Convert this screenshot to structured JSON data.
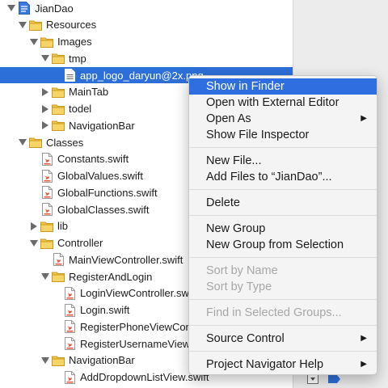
{
  "navigator": {
    "rows": [
      {
        "label": "JianDao",
        "icon": "xcode-project-icon",
        "indent": 0,
        "tri": "open",
        "selected": false
      },
      {
        "label": "Resources",
        "icon": "folder-icon",
        "indent": 1,
        "tri": "open",
        "selected": false
      },
      {
        "label": "Images",
        "icon": "folder-icon",
        "indent": 2,
        "tri": "open",
        "selected": false
      },
      {
        "label": "tmp",
        "icon": "folder-icon",
        "indent": 3,
        "tri": "open",
        "selected": false
      },
      {
        "label": "app_logo_daryun@2x.png",
        "icon": "image-file-icon",
        "indent": 4,
        "tri": "none",
        "selected": true
      },
      {
        "label": "MainTab",
        "icon": "folder-icon",
        "indent": 3,
        "tri": "closed",
        "selected": false
      },
      {
        "label": "todel",
        "icon": "folder-icon",
        "indent": 3,
        "tri": "closed",
        "selected": false
      },
      {
        "label": "NavigationBar",
        "icon": "folder-icon",
        "indent": 3,
        "tri": "closed",
        "selected": false
      },
      {
        "label": "Classes",
        "icon": "folder-icon",
        "indent": 1,
        "tri": "open",
        "selected": false
      },
      {
        "label": "Constants.swift",
        "icon": "swift-file-icon",
        "indent": 2,
        "tri": "none",
        "selected": false
      },
      {
        "label": "GlobalValues.swift",
        "icon": "swift-file-icon",
        "indent": 2,
        "tri": "none",
        "selected": false
      },
      {
        "label": "GlobalFunctions.swift",
        "icon": "swift-file-icon",
        "indent": 2,
        "tri": "none",
        "selected": false
      },
      {
        "label": "GlobalClasses.swift",
        "icon": "swift-file-icon",
        "indent": 2,
        "tri": "none",
        "selected": false
      },
      {
        "label": "lib",
        "icon": "folder-icon",
        "indent": 2,
        "tri": "closed",
        "selected": false
      },
      {
        "label": "Controller",
        "icon": "folder-icon",
        "indent": 2,
        "tri": "open",
        "selected": false
      },
      {
        "label": "MainViewController.swift",
        "icon": "swift-file-icon",
        "indent": 3,
        "tri": "none",
        "selected": false
      },
      {
        "label": "RegisterAndLogin",
        "icon": "folder-icon",
        "indent": 3,
        "tri": "open",
        "selected": false
      },
      {
        "label": "LoginViewController.swift",
        "icon": "swift-file-icon",
        "indent": 4,
        "tri": "none",
        "selected": false
      },
      {
        "label": "Login.swift",
        "icon": "swift-file-icon",
        "indent": 4,
        "tri": "none",
        "selected": false
      },
      {
        "label": "RegisterPhoneViewControll",
        "icon": "swift-file-icon",
        "indent": 4,
        "tri": "none",
        "selected": false
      },
      {
        "label": "RegisterUsernameViewCon",
        "icon": "swift-file-icon",
        "indent": 4,
        "tri": "none",
        "selected": false
      },
      {
        "label": "NavigationBar",
        "icon": "folder-icon",
        "indent": 3,
        "tri": "open",
        "selected": false
      },
      {
        "label": "AddDropdownListView.swift",
        "icon": "swift-file-icon",
        "indent": 4,
        "tri": "none",
        "selected": false
      }
    ]
  },
  "context_menu": {
    "items": [
      {
        "label": "Show in Finder",
        "type": "item",
        "highlighted": true,
        "enabled": true,
        "submenu": false
      },
      {
        "label": "Open with External Editor",
        "type": "item",
        "highlighted": false,
        "enabled": true,
        "submenu": false
      },
      {
        "label": "Open As",
        "type": "item",
        "highlighted": false,
        "enabled": true,
        "submenu": true
      },
      {
        "label": "Show File Inspector",
        "type": "item",
        "highlighted": false,
        "enabled": true,
        "submenu": false
      },
      {
        "type": "separator"
      },
      {
        "label": "New File...",
        "type": "item",
        "highlighted": false,
        "enabled": true,
        "submenu": false
      },
      {
        "label": "Add Files to “JianDao”...",
        "type": "item",
        "highlighted": false,
        "enabled": true,
        "submenu": false
      },
      {
        "type": "separator"
      },
      {
        "label": "Delete",
        "type": "item",
        "highlighted": false,
        "enabled": true,
        "submenu": false
      },
      {
        "type": "separator"
      },
      {
        "label": "New Group",
        "type": "item",
        "highlighted": false,
        "enabled": true,
        "submenu": false
      },
      {
        "label": "New Group from Selection",
        "type": "item",
        "highlighted": false,
        "enabled": true,
        "submenu": false
      },
      {
        "type": "separator"
      },
      {
        "label": "Sort by Name",
        "type": "item",
        "highlighted": false,
        "enabled": false,
        "submenu": false
      },
      {
        "label": "Sort by Type",
        "type": "item",
        "highlighted": false,
        "enabled": false,
        "submenu": false
      },
      {
        "type": "separator"
      },
      {
        "label": "Find in Selected Groups...",
        "type": "item",
        "highlighted": false,
        "enabled": false,
        "submenu": false
      },
      {
        "type": "separator"
      },
      {
        "label": "Source Control",
        "type": "item",
        "highlighted": false,
        "enabled": true,
        "submenu": true
      },
      {
        "type": "separator"
      },
      {
        "label": "Project Navigator Help",
        "type": "item",
        "highlighted": false,
        "enabled": true,
        "submenu": true
      }
    ],
    "submenu_glyph": "▶"
  },
  "colors": {
    "selection": "#2d6fd9",
    "menu_highlight": "#2e6ee0",
    "folder": "#f0c64a",
    "swift": "#e8543a",
    "right_pane": "#ececec"
  },
  "bottom_icons": [
    "filter-icon",
    "breakpoint-tag-icon"
  ]
}
